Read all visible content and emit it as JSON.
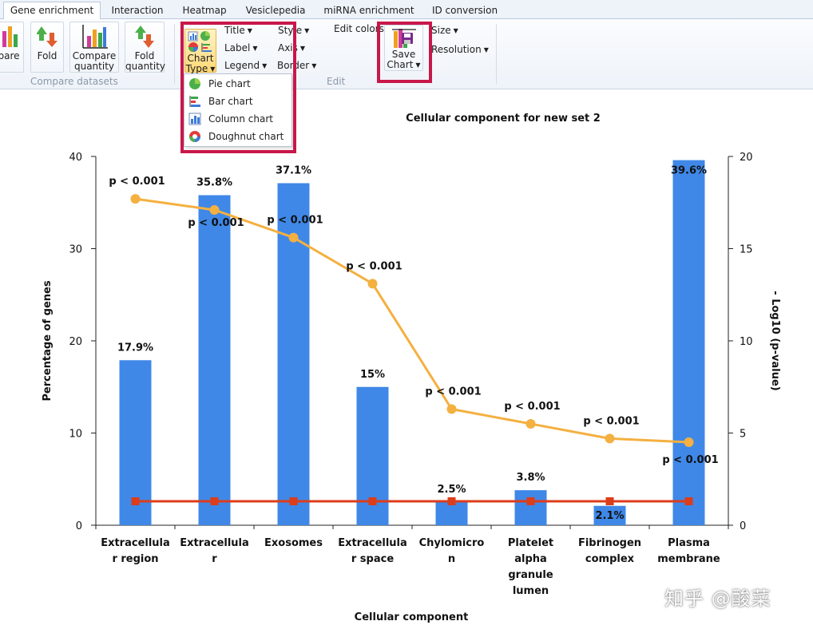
{
  "tabs": [
    {
      "label": "Gene enrichment",
      "active": true
    },
    {
      "label": "Interaction"
    },
    {
      "label": "Heatmap"
    },
    {
      "label": "Vesiclepedia"
    },
    {
      "label": "miRNA enrichment"
    },
    {
      "label": "ID conversion"
    }
  ],
  "ribbon": {
    "compare_group": {
      "label": "Compare datasets",
      "compare_partial": "pare",
      "fold": "Fold",
      "compare_quantity": [
        "Compare",
        "quantity"
      ],
      "fold_quantity": [
        "Fold",
        "quantity"
      ]
    },
    "edit_group": {
      "label": "Edit",
      "chart_type": [
        "Chart",
        "Type"
      ],
      "title": "Title",
      "label_btn": "Label",
      "legend": "Legend",
      "style": "Style",
      "axis": "Axis",
      "border": "Border",
      "edit_colors": "Edit colors"
    },
    "save_group": {
      "save_chart": [
        "Save",
        "Chart"
      ],
      "size": "Size",
      "resolution": "Resolution"
    }
  },
  "chart_type_menu": {
    "items": [
      {
        "label": "Pie chart",
        "icon": "pie-chart-icon"
      },
      {
        "label": "Bar chart",
        "icon": "bar-chart-icon"
      },
      {
        "label": "Column chart",
        "icon": "column-chart-icon"
      },
      {
        "label": "Doughnut chart",
        "icon": "doughnut-chart-icon"
      }
    ]
  },
  "colors": {
    "highlight": "#c8174a",
    "bar": "#3f88e8",
    "pvalue_line": "#f4b040",
    "threshold_line": "#dc3d1a"
  },
  "chart_data": {
    "type": "bar",
    "title": "Cellular component for new set 2",
    "xlabel": "Cellular component",
    "ylabel": "Percentage of genes",
    "y2label": "- Log10 (p-value)",
    "ylim": [
      0,
      40
    ],
    "y2lim": [
      0,
      20
    ],
    "yticks": [
      "0",
      "10",
      "20",
      "30",
      "40"
    ],
    "y2ticks": [
      "0",
      "5",
      "10",
      "15",
      "20"
    ],
    "categories": [
      [
        "Extracellula",
        "r region"
      ],
      [
        "Extracellula",
        "r"
      ],
      [
        "Exosomes"
      ],
      [
        "Extracellula",
        "r space"
      ],
      [
        "Chylomicro",
        "n"
      ],
      [
        "Platelet",
        "alpha",
        "granule",
        "lumen"
      ],
      [
        "Fibrinogen",
        "complex"
      ],
      [
        "Plasma",
        "membrane"
      ]
    ],
    "series": [
      {
        "type": "bar",
        "axis": "left",
        "values": [
          17.9,
          35.8,
          37.1,
          15,
          2.5,
          3.8,
          2.1,
          39.6
        ],
        "labels": [
          "17.9%",
          "35.8%",
          "37.1%",
          "15%",
          "2.5%",
          "3.8%",
          "2.1%",
          "39.6%"
        ]
      },
      {
        "type": "line",
        "axis": "right",
        "values": [
          17.7,
          17.1,
          15.6,
          13.1,
          6.3,
          5.5,
          4.7,
          4.5
        ],
        "labels": [
          "p < 0.001",
          "p < 0.001",
          "p < 0.001",
          "p < 0.001",
          "p < 0.001",
          "p < 0.001",
          "p < 0.001",
          "p < 0.001"
        ]
      },
      {
        "type": "line",
        "axis": "right",
        "values": [
          1.3,
          1.3,
          1.3,
          1.3,
          1.3,
          1.3,
          1.3,
          1.3
        ]
      }
    ],
    "grid": false
  },
  "watermark": "知乎 @酸菜"
}
